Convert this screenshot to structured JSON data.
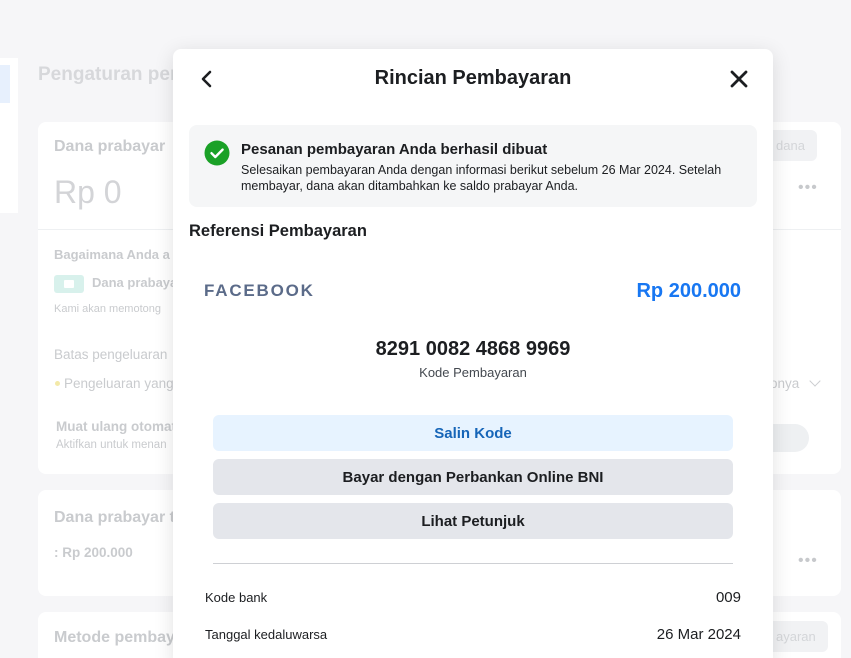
{
  "background": {
    "page_title": "Pengaturan per",
    "card1": {
      "heading": "Dana prabayar",
      "balance": "Rp 0",
      "add_funds_button": "dana",
      "question": "Bagaimana Anda a",
      "option_label": "Dana prabaya",
      "option_note": "Kami akan memotong",
      "limit_label": "Batas pengeluaran",
      "limit_item": "Pengeluaran yang",
      "limit_suffix": "onya",
      "auto_reload_title": "Muat ulang otomat",
      "auto_reload_desc": "Aktifkan untuk menan"
    },
    "card2": {
      "heading": "Dana prabayar te",
      "amount": ": Rp 200.000"
    },
    "card3": {
      "heading": "Metode pembaya",
      "button": "ayaran"
    }
  },
  "modal": {
    "title": "Rincian Pembayaran",
    "alert": {
      "title": "Pesanan pembayaran Anda berhasil dibuat",
      "body": "Selesaikan pembayaran Anda dengan informasi berikut sebelum 26 Mar 2024. Setelah membayar, dana akan ditambahkan ke saldo prabayar Anda.",
      "color": "#1aa127"
    },
    "reference_heading": "Referensi Pembayaran",
    "merchant_logo": "FACEBOOK",
    "amount": "Rp 200.000",
    "payment_code": "8291 0082 4868 9969",
    "payment_code_label": "Kode Pembayaran",
    "buttons": {
      "copy": "Salin Kode",
      "pay_bni": "Bayar dengan Perbankan Online BNI",
      "guide": "Lihat Petunjuk"
    },
    "details": [
      {
        "label": "Kode bank",
        "value": "009"
      },
      {
        "label": "Tanggal kedaluwarsa",
        "value": "26 Mar 2024"
      }
    ]
  }
}
